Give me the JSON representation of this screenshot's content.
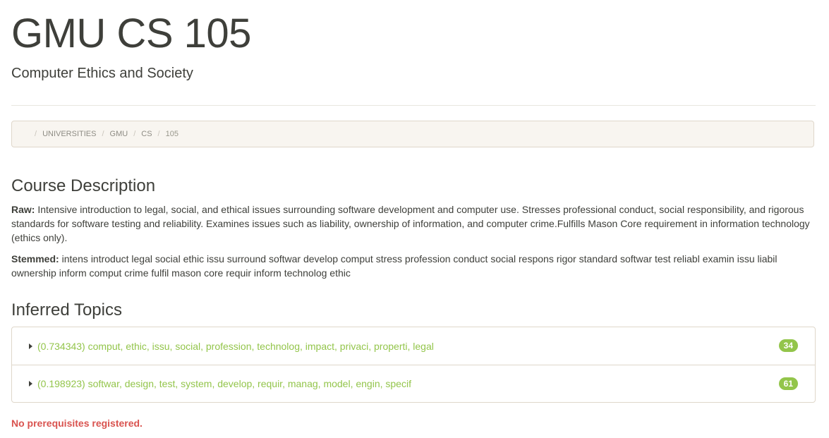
{
  "header": {
    "title": "GMU CS 105",
    "subtitle": "Computer Ethics and Society"
  },
  "breadcrumb": [
    "UNIVERSITIES",
    "GMU",
    "CS",
    "105"
  ],
  "description": {
    "heading": "Course Description",
    "raw_label": "Raw:",
    "raw_text": "Intensive introduction to legal, social, and ethical issues surrounding software development and computer use. Stresses professional conduct, social responsibility, and rigorous standards for software testing and reliability. Examines issues such as liability, ownership of information, and computer crime.Fulfills Mason Core requirement in information technology (ethics only).",
    "stemmed_label": "Stemmed:",
    "stemmed_text": "intens introduct legal social ethic issu surround softwar develop comput stress profession conduct social respons rigor standard softwar test reliabl examin issu liabil ownership inform comput crime fulfil mason core requir inform technolog ethic"
  },
  "topics": {
    "heading": "Inferred Topics",
    "items": [
      {
        "label": "(0.734343) comput, ethic, issu, social, profession, technolog, impact, privaci, properti, legal",
        "count": "34"
      },
      {
        "label": "(0.198923) softwar, design, test, system, develop, requir, manag, model, engin, specif",
        "count": "61"
      }
    ]
  },
  "prerequisites": {
    "message": "No prerequisites registered."
  },
  "colors": {
    "accent": "#93c54b",
    "danger": "#d9534f",
    "breadcrumb_bg": "#f8f5f0"
  }
}
